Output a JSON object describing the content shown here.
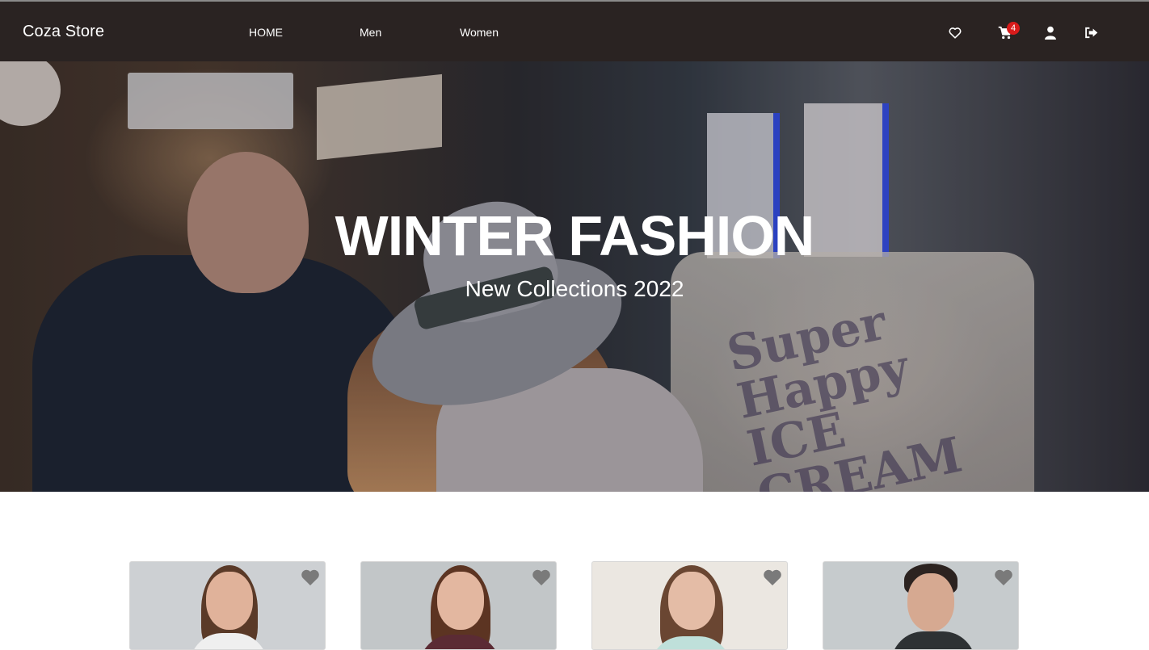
{
  "navbar": {
    "brand": "Coza Store",
    "links": [
      {
        "label": "HOME"
      },
      {
        "label": "Men"
      },
      {
        "label": "Women"
      }
    ],
    "icons": {
      "wishlist": "heart-icon",
      "cart": "cart-icon",
      "account": "user-icon",
      "logout": "logout-icon"
    },
    "cart_count": "4"
  },
  "hero": {
    "title": "WINTER FASHION",
    "subtitle": "New Collections 2022",
    "background_text": "Super Happy ICE CREAM"
  },
  "products": [
    {
      "favorite_icon": "heart-icon"
    },
    {
      "favorite_icon": "heart-icon"
    },
    {
      "favorite_icon": "heart-icon"
    },
    {
      "favorite_icon": "heart-icon"
    }
  ],
  "colors": {
    "navbar_bg": "#2a2322",
    "badge": "#d81b1b",
    "favorite_icon": "#7a7a7a"
  }
}
